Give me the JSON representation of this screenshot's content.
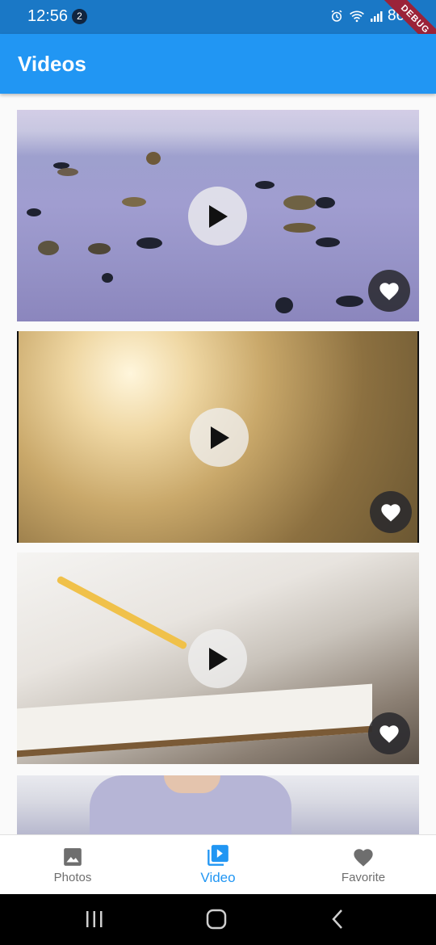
{
  "status_bar": {
    "time": "12:56",
    "notification_count": "2",
    "battery": "86%",
    "debug_banner": "DEBUG",
    "icons": [
      "alarm-icon",
      "wifi-icon",
      "signal-icon"
    ]
  },
  "app_bar": {
    "title": "Videos"
  },
  "videos": [
    {
      "name": "beach-pebbles-video",
      "play_icon": "play-icon",
      "favorite_icon": "heart-icon"
    },
    {
      "name": "golden-light-video",
      "play_icon": "play-icon",
      "favorite_icon": "heart-icon"
    },
    {
      "name": "child-drawing-video",
      "play_icon": "play-icon",
      "favorite_icon": "heart-icon"
    },
    {
      "name": "hoodie-person-video"
    }
  ],
  "bottom_nav": {
    "items": [
      {
        "label": "Photos",
        "icon": "image-icon",
        "active": false
      },
      {
        "label": "Video",
        "icon": "video-library-icon",
        "active": true
      },
      {
        "label": "Favorite",
        "icon": "heart-icon",
        "active": false
      }
    ]
  },
  "system_nav": {
    "icons": [
      "recent-apps-icon",
      "home-icon",
      "back-icon"
    ]
  },
  "colors": {
    "primary": "#2196f3",
    "status_bar": "#1a78c6",
    "inactive": "#6e6e6e",
    "fav_bg": "#28282d"
  }
}
